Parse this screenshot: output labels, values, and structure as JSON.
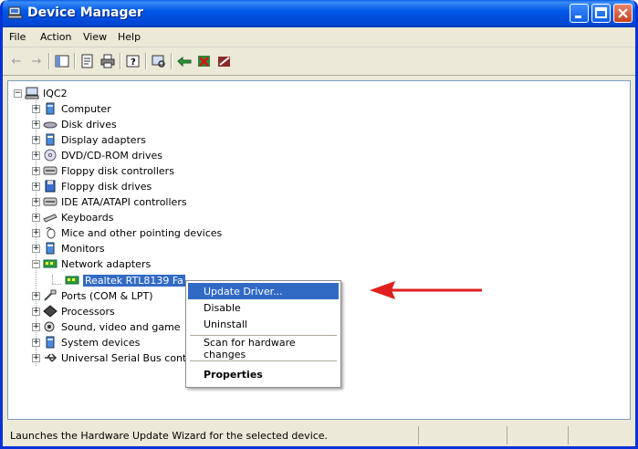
{
  "window": {
    "title": "Device Manager"
  },
  "menu": [
    "File",
    "Action",
    "View",
    "Help"
  ],
  "toolbar": [
    "back-icon",
    "forward-icon",
    "console-tree-icon",
    "properties-icon",
    "print-icon",
    "help-icon",
    "scan-hardware-icon",
    "update-driver-icon",
    "uninstall-icon",
    "disable-icon"
  ],
  "tree": {
    "root": "IQC2",
    "items": [
      "Computer",
      "Disk drives",
      "Display adapters",
      "DVD/CD-ROM drives",
      "Floppy disk controllers",
      "Floppy disk drives",
      "IDE ATA/ATAPI controllers",
      "Keyboards",
      "Mice and other pointing devices",
      "Monitors",
      "Network adapters",
      "Ports (COM & LPT)",
      "Processors",
      "Sound, video and game",
      "System devices",
      "Universal Serial Bus cont"
    ],
    "selected_device": "Realtek RTL8139 Fa"
  },
  "context_menu": {
    "items": [
      "Update Driver...",
      "Disable",
      "Uninstall",
      "Scan for hardware changes",
      "Properties"
    ]
  },
  "status": {
    "text": "Launches the Hardware Update Wizard for the selected device."
  },
  "colors": {
    "title_blue": "#0058e6",
    "selection": "#316ac5",
    "arrow_red": "#e0201e"
  }
}
